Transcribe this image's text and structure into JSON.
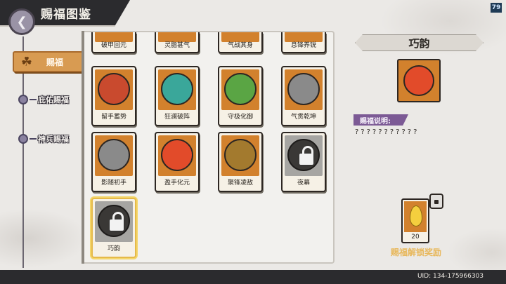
{
  "header": {
    "title": "赐福图鉴",
    "level_badge": "79"
  },
  "nav": {
    "active": {
      "label": "赐福"
    },
    "items": [
      {
        "label": "庇佑赐福"
      },
      {
        "label": "神兵赐福"
      }
    ]
  },
  "grid": {
    "top_row": [
      "破甲回元",
      "灵脂甚气",
      "气战其身",
      "息锋养锐"
    ],
    "cards": [
      {
        "label": "留手蓄势",
        "color": "#c94a2e",
        "locked": false
      },
      {
        "label": "狂澜破阵",
        "color": "#3aa79a",
        "locked": false
      },
      {
        "label": "守极化御",
        "color": "#5aa544",
        "locked": false
      },
      {
        "label": "气贯乾坤",
        "color": "#8a8a8a",
        "locked": false
      },
      {
        "label": "影随初手",
        "color": "#8a8a8a",
        "locked": false
      },
      {
        "label": "盈手化元",
        "color": "#e24b2a",
        "locked": false
      },
      {
        "label": "聚锋凌敌",
        "color": "#a37a2e",
        "locked": false
      },
      {
        "label": "夜幕",
        "color": "#3a3836",
        "locked": true
      },
      {
        "label": "巧韵",
        "color": "#3a3836",
        "locked": true,
        "selected": true
      }
    ]
  },
  "detail": {
    "title": "巧韵",
    "desc_tag": "赐福说明:",
    "desc_text": "???????????",
    "reward_count": "20",
    "reward_caption": "赐福解锁奖励"
  },
  "footer": {
    "uid": "UID: 134-175966303"
  }
}
